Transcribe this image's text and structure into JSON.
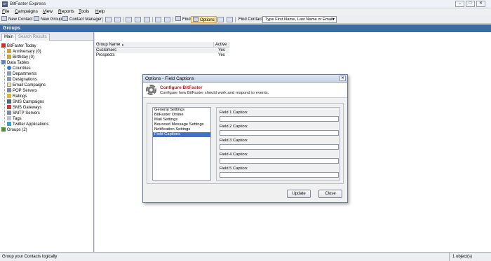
{
  "window": {
    "title": "BitFaster Express",
    "app_icon_text": "BF",
    "controls": {
      "minimize": "–",
      "maximize": "□",
      "close": "✕"
    }
  },
  "menu": [
    "File",
    "Campaigns",
    "View",
    "Reports",
    "Tools",
    "Help"
  ],
  "toolbar": {
    "new_contact": "New Contact",
    "new_group": "New Group",
    "contact_manager": "Contact Manager",
    "find": "Find",
    "options": "Options",
    "find_contact_label": "Find Contact",
    "find_contact_placeholder": "Type First Name, Last Name or Email"
  },
  "header": {
    "title": "Groups"
  },
  "left_tabs": [
    "Main",
    "Search Results"
  ],
  "tree": {
    "today": {
      "label": "BitFaster Today",
      "children": [
        "Anniversary (0)",
        "Birthday (0)"
      ]
    },
    "data_tables": {
      "label": "Data Tables",
      "children": [
        "Countries",
        "Departments",
        "Designations",
        "Email Campaigns",
        "POP Servers",
        "Ratings",
        "SMS Campaigns",
        "SMS Gateways",
        "SMTP Servers",
        "Tags",
        "Twitter Applications"
      ]
    },
    "groups": {
      "label": "Groups (2)"
    }
  },
  "grid": {
    "columns": [
      "Group Name",
      "Active"
    ],
    "sort_indicator": "▲",
    "rows": [
      {
        "name": "Customers",
        "active": "Yes"
      },
      {
        "name": "Prospects",
        "active": "Yes"
      }
    ]
  },
  "status": {
    "left": "Group your Contacts logically",
    "right": "1 object(s)"
  },
  "dialog": {
    "title": "Options - Field Captions",
    "close": "✕",
    "banner_title": "Configure BitFaster",
    "banner_subtitle": "Configure how BitFaster should work and respond to events.",
    "categories": [
      "General Settings",
      "BitFaster Online",
      "Mail Settings",
      "Bounced Message Settings",
      "Notification Settings",
      "Field Captions"
    ],
    "selected_category": "Field Captions",
    "fields": [
      {
        "label": "Field 1 Caption:",
        "value": ""
      },
      {
        "label": "Field 2 Caption:",
        "value": ""
      },
      {
        "label": "Field 3 Caption:",
        "value": ""
      },
      {
        "label": "Field 4 Caption:",
        "value": ""
      },
      {
        "label": "Field 5 Caption:",
        "value": ""
      }
    ],
    "buttons": {
      "update": "Update",
      "close": "Close"
    }
  }
}
